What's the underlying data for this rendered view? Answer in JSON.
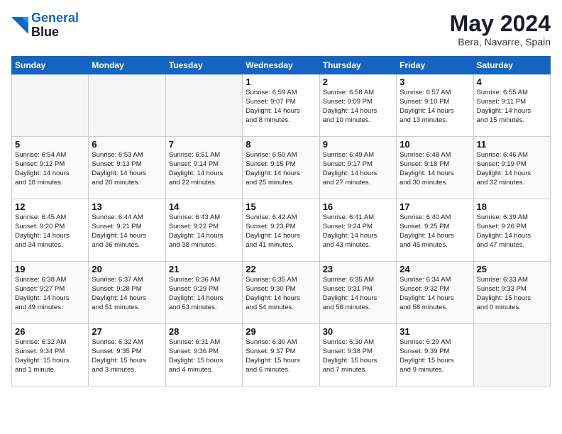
{
  "header": {
    "logo_line1": "General",
    "logo_line2": "Blue",
    "month_title": "May 2024",
    "location": "Bera, Navarre, Spain"
  },
  "weekdays": [
    "Sunday",
    "Monday",
    "Tuesday",
    "Wednesday",
    "Thursday",
    "Friday",
    "Saturday"
  ],
  "weeks": [
    [
      {
        "day": "",
        "info": ""
      },
      {
        "day": "",
        "info": ""
      },
      {
        "day": "",
        "info": ""
      },
      {
        "day": "1",
        "info": "Sunrise: 6:59 AM\nSunset: 9:07 PM\nDaylight: 14 hours\nand 8 minutes."
      },
      {
        "day": "2",
        "info": "Sunrise: 6:58 AM\nSunset: 9:09 PM\nDaylight: 14 hours\nand 10 minutes."
      },
      {
        "day": "3",
        "info": "Sunrise: 6:57 AM\nSunset: 9:10 PM\nDaylight: 14 hours\nand 13 minutes."
      },
      {
        "day": "4",
        "info": "Sunrise: 6:55 AM\nSunset: 9:11 PM\nDaylight: 14 hours\nand 15 minutes."
      }
    ],
    [
      {
        "day": "5",
        "info": "Sunrise: 6:54 AM\nSunset: 9:12 PM\nDaylight: 14 hours\nand 18 minutes."
      },
      {
        "day": "6",
        "info": "Sunrise: 6:53 AM\nSunset: 9:13 PM\nDaylight: 14 hours\nand 20 minutes."
      },
      {
        "day": "7",
        "info": "Sunrise: 6:51 AM\nSunset: 9:14 PM\nDaylight: 14 hours\nand 22 minutes."
      },
      {
        "day": "8",
        "info": "Sunrise: 6:50 AM\nSunset: 9:15 PM\nDaylight: 14 hours\nand 25 minutes."
      },
      {
        "day": "9",
        "info": "Sunrise: 6:49 AM\nSunset: 9:17 PM\nDaylight: 14 hours\nand 27 minutes."
      },
      {
        "day": "10",
        "info": "Sunrise: 6:48 AM\nSunset: 9:18 PM\nDaylight: 14 hours\nand 30 minutes."
      },
      {
        "day": "11",
        "info": "Sunrise: 6:46 AM\nSunset: 9:19 PM\nDaylight: 14 hours\nand 32 minutes."
      }
    ],
    [
      {
        "day": "12",
        "info": "Sunrise: 6:45 AM\nSunset: 9:20 PM\nDaylight: 14 hours\nand 34 minutes."
      },
      {
        "day": "13",
        "info": "Sunrise: 6:44 AM\nSunset: 9:21 PM\nDaylight: 14 hours\nand 36 minutes."
      },
      {
        "day": "14",
        "info": "Sunrise: 6:43 AM\nSunset: 9:22 PM\nDaylight: 14 hours\nand 38 minutes."
      },
      {
        "day": "15",
        "info": "Sunrise: 6:42 AM\nSunset: 9:23 PM\nDaylight: 14 hours\nand 41 minutes."
      },
      {
        "day": "16",
        "info": "Sunrise: 6:41 AM\nSunset: 9:24 PM\nDaylight: 14 hours\nand 43 minutes."
      },
      {
        "day": "17",
        "info": "Sunrise: 6:40 AM\nSunset: 9:25 PM\nDaylight: 14 hours\nand 45 minutes."
      },
      {
        "day": "18",
        "info": "Sunrise: 6:39 AM\nSunset: 9:26 PM\nDaylight: 14 hours\nand 47 minutes."
      }
    ],
    [
      {
        "day": "19",
        "info": "Sunrise: 6:38 AM\nSunset: 9:27 PM\nDaylight: 14 hours\nand 49 minutes."
      },
      {
        "day": "20",
        "info": "Sunrise: 6:37 AM\nSunset: 9:28 PM\nDaylight: 14 hours\nand 51 minutes."
      },
      {
        "day": "21",
        "info": "Sunrise: 6:36 AM\nSunset: 9:29 PM\nDaylight: 14 hours\nand 53 minutes."
      },
      {
        "day": "22",
        "info": "Sunrise: 6:35 AM\nSunset: 9:30 PM\nDaylight: 14 hours\nand 54 minutes."
      },
      {
        "day": "23",
        "info": "Sunrise: 6:35 AM\nSunset: 9:31 PM\nDaylight: 14 hours\nand 56 minutes."
      },
      {
        "day": "24",
        "info": "Sunrise: 6:34 AM\nSunset: 9:32 PM\nDaylight: 14 hours\nand 58 minutes."
      },
      {
        "day": "25",
        "info": "Sunrise: 6:33 AM\nSunset: 9:33 PM\nDaylight: 15 hours\nand 0 minutes."
      }
    ],
    [
      {
        "day": "26",
        "info": "Sunrise: 6:32 AM\nSunset: 9:34 PM\nDaylight: 15 hours\nand 1 minute."
      },
      {
        "day": "27",
        "info": "Sunrise: 6:32 AM\nSunset: 9:35 PM\nDaylight: 15 hours\nand 3 minutes."
      },
      {
        "day": "28",
        "info": "Sunrise: 6:31 AM\nSunset: 9:36 PM\nDaylight: 15 hours\nand 4 minutes."
      },
      {
        "day": "29",
        "info": "Sunrise: 6:30 AM\nSunset: 9:37 PM\nDaylight: 15 hours\nand 6 minutes."
      },
      {
        "day": "30",
        "info": "Sunrise: 6:30 AM\nSunset: 9:38 PM\nDaylight: 15 hours\nand 7 minutes."
      },
      {
        "day": "31",
        "info": "Sunrise: 6:29 AM\nSunset: 9:39 PM\nDaylight: 15 hours\nand 9 minutes."
      },
      {
        "day": "",
        "info": ""
      }
    ]
  ]
}
